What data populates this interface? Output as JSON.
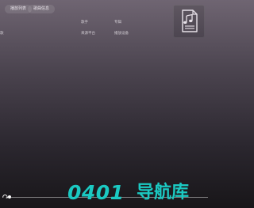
{
  "top_bar": {
    "buttons": [
      "播放列表",
      "歌曲信息"
    ]
  },
  "song_info": {
    "row1": [
      "",
      "歌手",
      "专辑"
    ],
    "row2": [
      "歌",
      "来源平台",
      "播放设备"
    ]
  },
  "player": {
    "progress": 0.0
  },
  "watermark": {
    "digits": "0401",
    "text": "导航库"
  },
  "colors": {
    "accent": "#1bc9c2",
    "background_top": "#6f6572",
    "background_bottom": "#181619"
  },
  "icons": {
    "cover": "music-sheet-icon",
    "loop": "loop-icon"
  }
}
